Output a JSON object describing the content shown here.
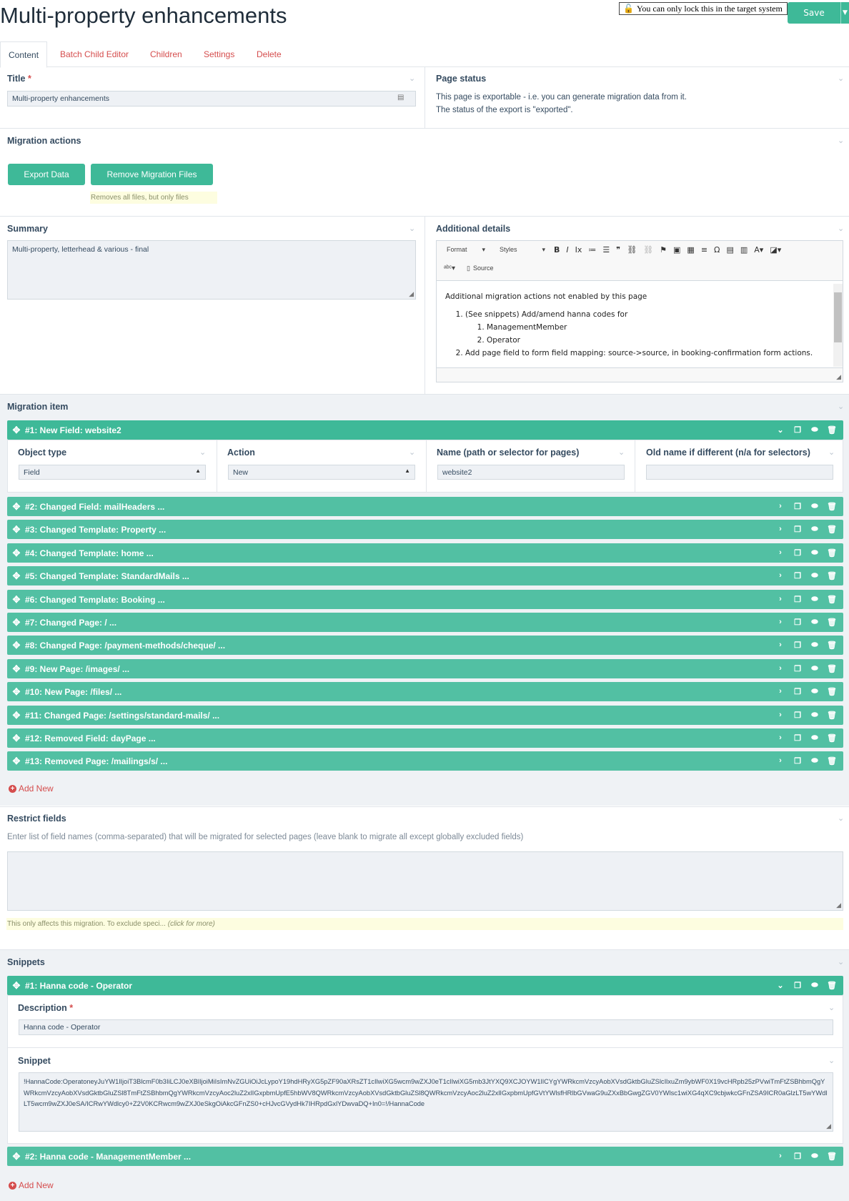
{
  "page": {
    "title": "Multi-property enhancements",
    "lock_notice": "You can only lock this in the target system",
    "save_label": "Save"
  },
  "tabs": [
    "Content",
    "Batch Child Editor",
    "Children",
    "Settings",
    "Delete"
  ],
  "title_field": {
    "label": "Title",
    "value": "Multi-property enhancements"
  },
  "page_status": {
    "label": "Page status",
    "line1": "This page is exportable - i.e. you can generate migration data from it.",
    "line2": "The status of the export is \"exported\"."
  },
  "migration_actions": {
    "label": "Migration actions",
    "export_label": "Export Data",
    "remove_label": "Remove Migration Files",
    "remove_note": "Removes all files, but only files"
  },
  "summary": {
    "label": "Summary",
    "value": "Multi-property, letterhead & various - final"
  },
  "additional_details": {
    "label": "Additional details",
    "toolbar": {
      "format": "Format",
      "styles": "Styles",
      "source": "Source"
    },
    "intro": "Additional migration actions not enabled by this page",
    "item1": "(See snippets) Add/amend hanna codes for",
    "sub1": "ManagementMember",
    "sub2": "Operator",
    "item2": "Add page field to form field mapping: source->source, in booking-confirmation form actions."
  },
  "migration_item": {
    "label": "Migration item",
    "open_item": {
      "title": "#1: New Field: website2",
      "object_type_label": "Object type",
      "object_type_value": "Field",
      "action_label": "Action",
      "action_value": "New",
      "name_label": "Name (path or selector for pages)",
      "name_value": "website2",
      "old_name_label": "Old name if different (n/a for selectors)",
      "old_name_value": ""
    },
    "items": [
      "#2: Changed Field: mailHeaders ...",
      "#3: Changed Template: Property ...",
      "#4: Changed Template: home ...",
      "#5: Changed Template: StandardMails ...",
      "#6: Changed Template: Booking ...",
      "#7: Changed Page: / ...",
      "#8: Changed Page: /payment-methods/cheque/ ...",
      "#9: New Page: /images/ ...",
      "#10: New Page: /files/ ...",
      "#11: Changed Page: /settings/standard-mails/ ...",
      "#12: Removed Field: dayPage ...",
      "#13: Removed Page: /mailings/s/ ..."
    ],
    "add_new": "Add New"
  },
  "restrict_fields": {
    "label": "Restrict fields",
    "description": "Enter list of field names (comma-separated) that will be migrated for selected pages (leave blank to migrate all except globally excluded fields)",
    "value": "",
    "note": "This only affects this migration. To exclude speci...",
    "note_more": "(click for more)"
  },
  "snippets": {
    "label": "Snippets",
    "open_item": {
      "title": "#1: Hanna code - Operator",
      "description_label": "Description",
      "description_value": "Hanna code - Operator",
      "snippet_label": "Snippet",
      "snippet_value": "!HannaCode:OperatoneyJuYW1lIjoiT3BlcmF0b3IiLCJ0eXBlIjoiMiIsImNvZGUiOiJcLypoY19hdHRyXG5pZF90aXRsZT1cIlwiXG5wcm9wZXJ0eT1cIlwiXG5mb3JtYXQ9XCJOYW1lICYgYWRkcmVzcyAobXVsdGktbGluZSlcIlxuZm9ybWF0X19vcHRpb25zPVwiTmFtZSBhbmQgYWRkcmVzcyAobXVsdGktbGluZSl8TmFtZSBhbmQgYWRkcmVzcyAoc2luZ2xlIGxpbmUpfE5hbWV8QWRkcmVzcyAobXVsdGktbGluZSl8QWRkcmVzcyAoc2luZ2xlIGxpbmUpfGVtYWlsfHRlbGVwaG9uZXxBbGwgZGV0YWlsc1wiXG4qXC9cbjwkcGFnZSA9ICR0aGlzLT5wYWdlLT5wcm9wZXJ0eSA/ICRwYWdlcy0+Z2V0KCRwcm9wZXJ0eSkgOiAkcGFnZS0+cHJvcGVydHk7IHRpdGxlYDwvaDQ+In0=!/HannaCode"
    },
    "items": [
      "#2: Hanna code - ManagementMember ..."
    ],
    "add_new": "Add New"
  },
  "colors": {
    "accent": "#3eb998",
    "accent_light": "#52c0a3",
    "danger": "#d54d4d",
    "text": "#354b60"
  }
}
